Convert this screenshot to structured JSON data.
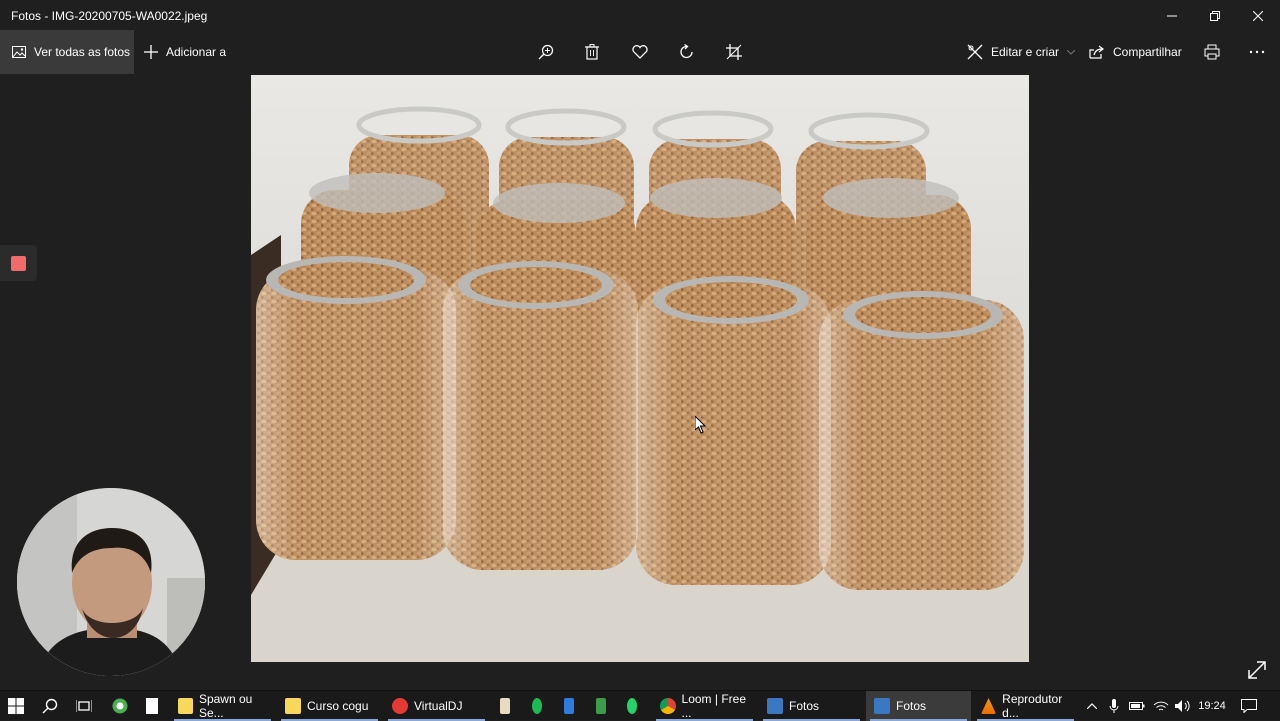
{
  "window": {
    "title": "Fotos - IMG-20200705-WA0022.jpeg",
    "minimize_icon": "minimize-icon",
    "restore_icon": "restore-icon",
    "close_icon": "close-icon"
  },
  "toolbar": {
    "view_all_label": "Ver todas as fotos",
    "add_to_label": "Adicionar a",
    "edit_create_label": "Editar e criar",
    "share_label": "Compartilhar",
    "icons": [
      "zoom-icon",
      "delete-icon",
      "favorite-icon",
      "rotate-icon",
      "crop-icon",
      "print-icon",
      "more-icon"
    ]
  },
  "colors": {
    "background": "#1f1f1f",
    "active_button": "#3a3a3a",
    "record_button": "#f26b6b",
    "taskbar": "#1a1a1a"
  },
  "taskbar": {
    "apps": [
      {
        "label": "Spawn ou Se...",
        "icon": "notepad-icon"
      },
      {
        "label": "Curso cogu",
        "icon": "notepad-icon"
      },
      {
        "label": "VirtualDJ",
        "icon": "virtualdj-icon"
      },
      {
        "label": "Loom | Free ...",
        "icon": "chrome-icon"
      },
      {
        "label": "Fotos",
        "icon": "photos-icon"
      },
      {
        "label": "Fotos",
        "icon": "photos-icon"
      },
      {
        "label": "Reprodutor d...",
        "icon": "vlc-icon"
      }
    ],
    "clock": "19:24"
  }
}
